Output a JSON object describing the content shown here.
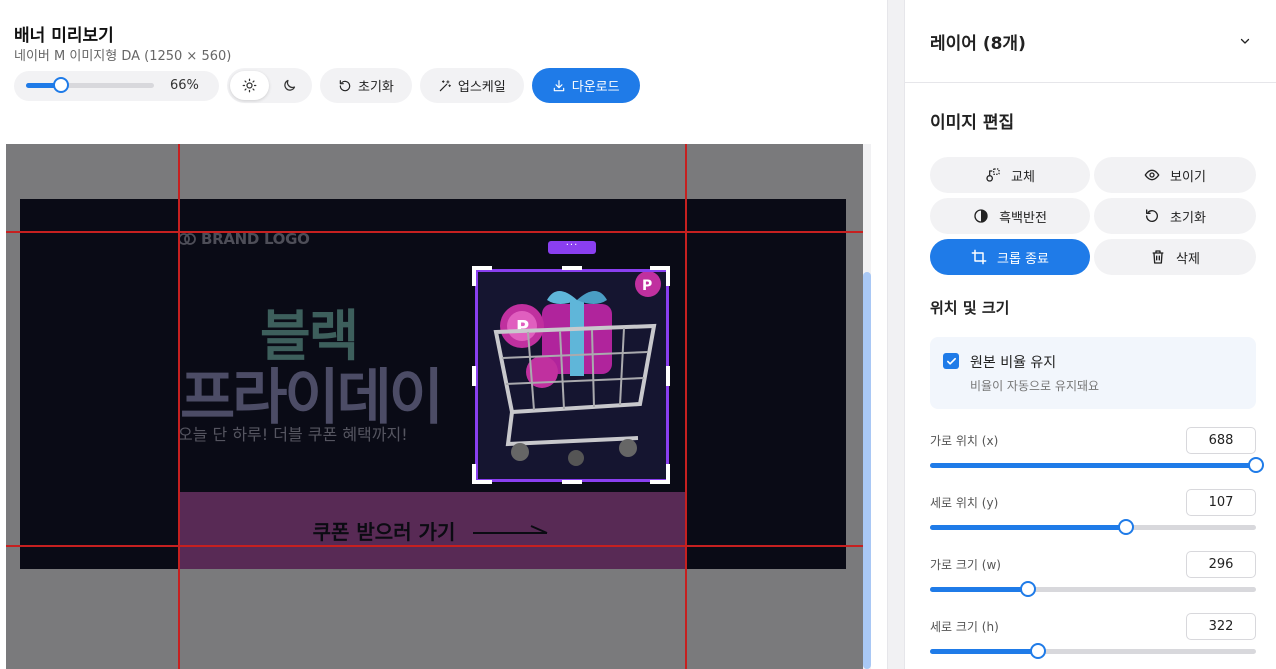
{
  "header": {
    "title": "배너 미리보기",
    "subtitle": "네이버 M 이미지형 DA (1250 × 560)"
  },
  "toolbar": {
    "zoom_value": "66%",
    "zoom_level": 0.27,
    "reset_label": "초기화",
    "upscale_label": "업스케일",
    "download_label": "다운로드"
  },
  "banner": {
    "brand_logo": "BRAND LOGO",
    "headline_line1": "블랙",
    "headline_line2": "프라이데이",
    "subcopy": "오늘 단 하루! 더블 쿠폰 혜택까지!",
    "cta_label": "쿠폰 받으러 가기",
    "selection_menu": "···"
  },
  "panel": {
    "layers_title": "레이어 (8개)",
    "edit_title": "이미지 편집",
    "buttons": {
      "replace": "교체",
      "show": "보이기",
      "invert": "흑백반전",
      "reset": "초기화",
      "crop_done": "크롭 종료",
      "delete": "삭제"
    },
    "position_title": "위치 및 크기",
    "keep_ratio_label": "원본 비율 유지",
    "keep_ratio_help": "비율이 자동으로 유지돼요",
    "fields": {
      "x": {
        "label": "가로 위치 (x)",
        "value": "688",
        "level": 1.0
      },
      "y": {
        "label": "세로 위치 (y)",
        "value": "107",
        "level": 0.6
      },
      "w": {
        "label": "가로 크기 (w)",
        "value": "296",
        "level": 0.3
      },
      "h": {
        "label": "세로 크기 (h)",
        "value": "322",
        "level": 0.33
      }
    }
  },
  "colors": {
    "accent": "#1f7be8",
    "selection": "#8a3ff0",
    "guide": "#c62020"
  }
}
